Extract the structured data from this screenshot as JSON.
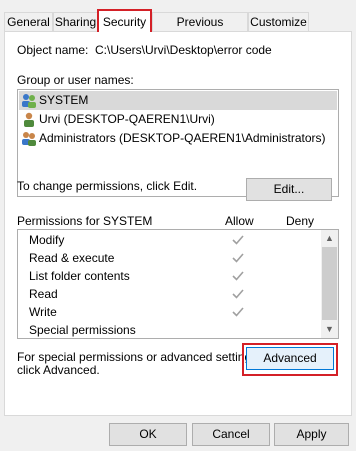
{
  "tabs": [
    "General",
    "Sharing",
    "Security",
    "Previous Versions",
    "Customize"
  ],
  "object_name_label": "Object name:",
  "object_name_value": "C:\\Users\\Urvi\\Desktop\\error code",
  "group_label": "Group or user names:",
  "users": [
    {
      "name": "SYSTEM",
      "icon": "system-users-icon"
    },
    {
      "name": "Urvi (DESKTOP-QAEREN1\\Urvi)",
      "icon": "user-icon"
    },
    {
      "name": "Administrators (DESKTOP-QAEREN1\\Administrators)",
      "icon": "admin-users-icon"
    }
  ],
  "change_perm_text": "To change permissions, click Edit.",
  "edit_button": "Edit...",
  "permissions_for": "Permissions for SYSTEM",
  "allow_label": "Allow",
  "deny_label": "Deny",
  "permissions": [
    {
      "name": "Modify",
      "allow": true
    },
    {
      "name": "Read & execute",
      "allow": true
    },
    {
      "name": "List folder contents",
      "allow": true
    },
    {
      "name": "Read",
      "allow": true
    },
    {
      "name": "Write",
      "allow": true
    },
    {
      "name": "Special permissions",
      "allow": false
    }
  ],
  "special_text_line1": "For special permissions or advanced settings,",
  "special_text_line2": "click Advanced.",
  "advanced_button": "Advanced",
  "ok_button": "OK",
  "cancel_button": "Cancel",
  "apply_button": "Apply",
  "colors": {
    "highlight": "#d42027",
    "checkmark": "#a0a0a0"
  }
}
